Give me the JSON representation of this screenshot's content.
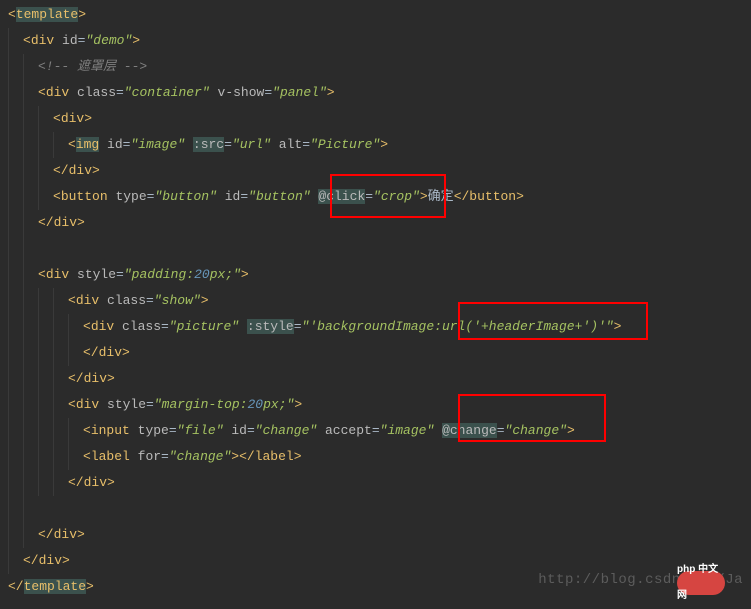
{
  "tags": {
    "template_open": "template",
    "template_close": "template",
    "div": "div",
    "img": "img",
    "button": "button",
    "input": "input",
    "label": "label"
  },
  "attrs": {
    "id": "id",
    "class": "class",
    "v_show": "v-show",
    "src": ":src",
    "alt": "alt",
    "type": "type",
    "at_click": "@click",
    "style": "style",
    "at_style": ":style",
    "accept": "accept",
    "at_change": "@change",
    "for": "for"
  },
  "vals": {
    "demo": "demo",
    "container": "container",
    "panel": "panel",
    "image": "image",
    "url": "url",
    "picture_alt": "Picture",
    "btn_type": "button",
    "btn_id": "button",
    "crop": "crop",
    "padding": "padding:",
    "px20": "20",
    "px_suffix": "px;",
    "show": "show",
    "picture": "picture",
    "bg_expr": "'backgroundImage:url('+headerImage+')'",
    "margin_top": "margin-top:",
    "file": "file",
    "change_id": "change",
    "accept_val": "image",
    "change_handler": "change"
  },
  "text": {
    "comment": "<!-- 遮罩层 -->",
    "confirm": "确定"
  },
  "watermark": "http://blog.csdn.net/Ja",
  "logo": "php 中文网"
}
